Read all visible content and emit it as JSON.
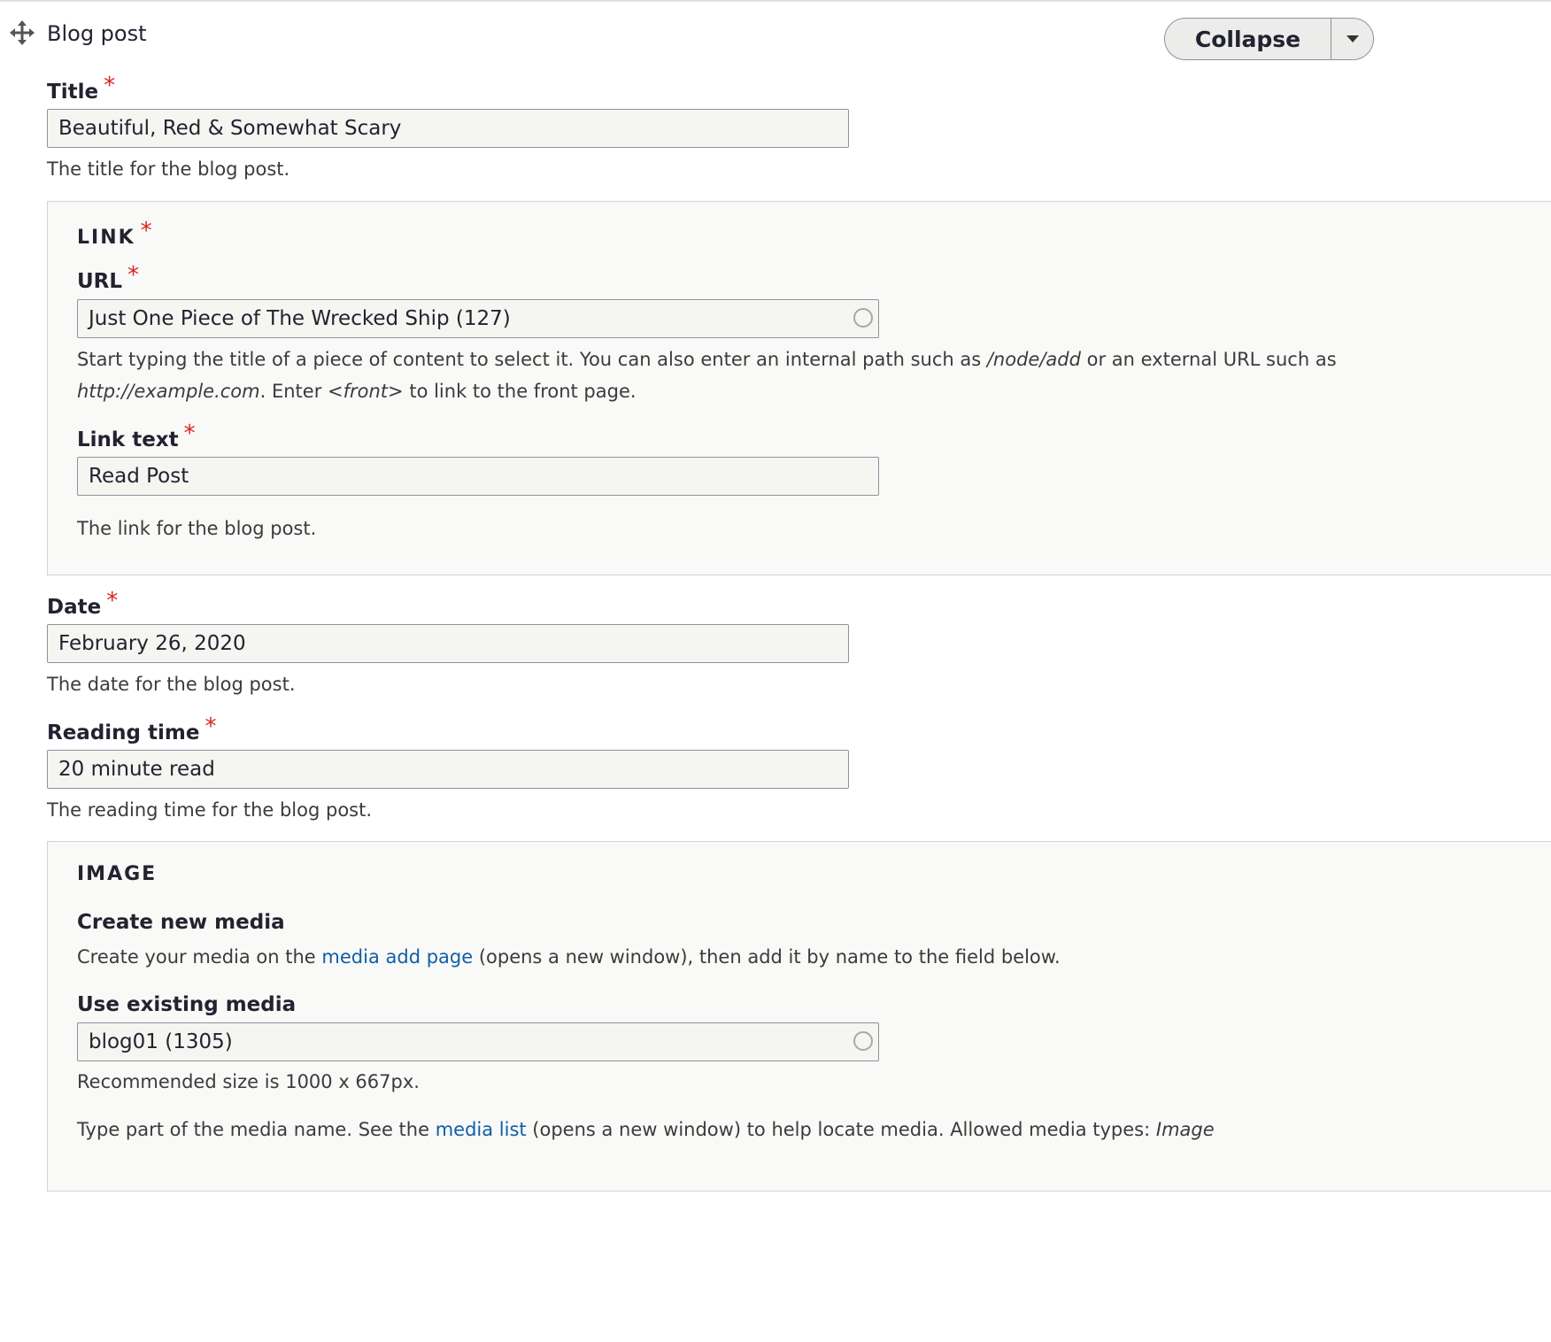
{
  "paragraph": {
    "title": "Blog post",
    "drag_icon": "move-icon",
    "collapse_label": "Collapse",
    "dropdown_icon": "chevron-down-icon"
  },
  "required_marker": "*",
  "title_field": {
    "label": "Title",
    "value": "Beautiful, Red & Somewhat Scary",
    "description": "The title for the blog post."
  },
  "link": {
    "legend": "LINK",
    "url": {
      "label": "URL",
      "value": "Just One Piece of The Wrecked Ship (127)",
      "desc_1": "Start typing the title of a piece of content to select it. You can also enter an internal path such as ",
      "desc_path": "/node/add",
      "desc_2": " or an external URL such as ",
      "desc_url": "http://example.com",
      "desc_3": ". Enter ",
      "desc_front": "<front>",
      "desc_4": " to link to the front page."
    },
    "link_text": {
      "label": "Link text",
      "value": "Read Post"
    },
    "description": "The link for the blog post."
  },
  "date_field": {
    "label": "Date",
    "value": "February 26, 2020",
    "description": "The date for the blog post."
  },
  "reading_time": {
    "label": "Reading time",
    "value": "20 minute read",
    "description": "The reading time for the blog post."
  },
  "image": {
    "legend": "IMAGE",
    "create_heading": "Create new media",
    "create_desc_1": "Create your media on the ",
    "create_link": "media add page",
    "create_desc_2": " (opens a new window), then add it by name to the field below.",
    "existing_label": "Use existing media",
    "existing_value": "blog01 (1305)",
    "size_note": "Recommended size is 1000 x 667px.",
    "help_1": "Type part of the media name. See the ",
    "help_link": "media list",
    "help_2": " (opens a new window) to help locate media. Allowed media types: ",
    "help_types": "Image"
  },
  "colors": {
    "required": "#dc2323",
    "link": "#0f5fa6",
    "field_background": "#f5f5f2",
    "fieldset_background": "#f9f9f8"
  }
}
